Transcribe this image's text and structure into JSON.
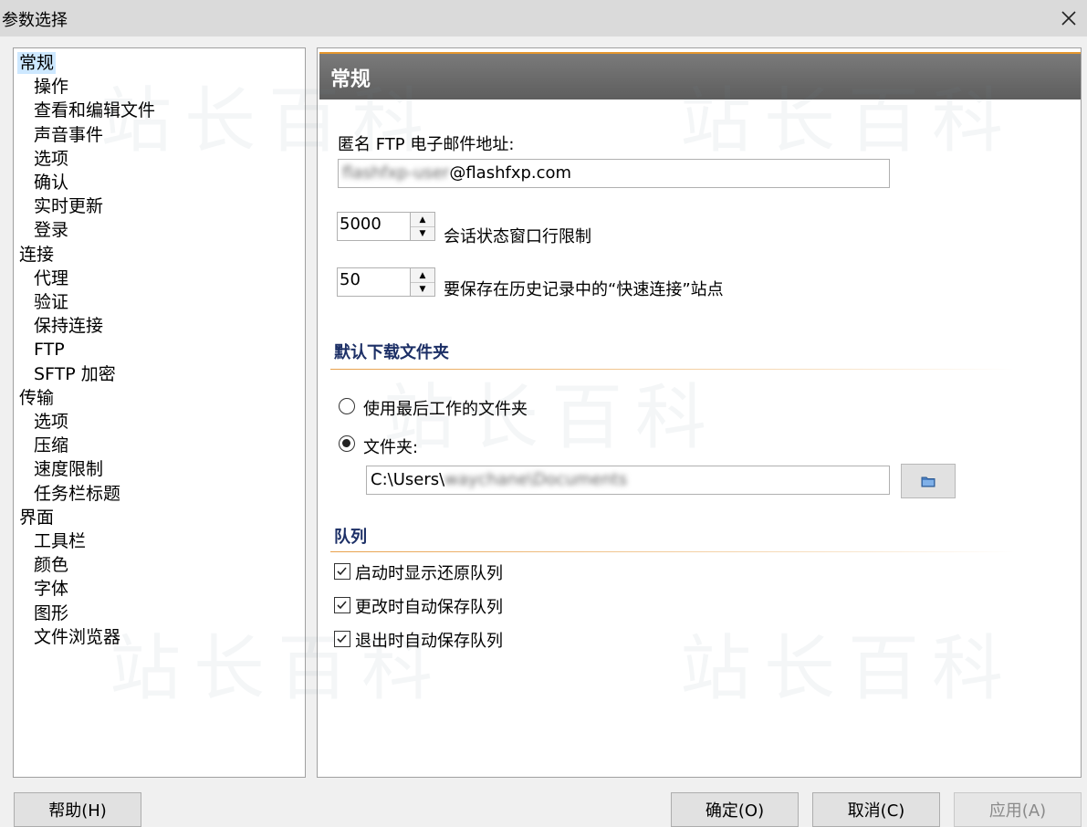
{
  "window": {
    "title": "参数选择"
  },
  "tree": [
    {
      "label": "常规",
      "level": 0,
      "selected": true
    },
    {
      "label": "操作",
      "level": 1
    },
    {
      "label": "查看和编辑文件",
      "level": 1
    },
    {
      "label": "声音事件",
      "level": 1
    },
    {
      "label": "选项",
      "level": 1
    },
    {
      "label": "确认",
      "level": 1
    },
    {
      "label": "实时更新",
      "level": 1
    },
    {
      "label": "登录",
      "level": 1
    },
    {
      "label": "连接",
      "level": 0
    },
    {
      "label": "代理",
      "level": 1
    },
    {
      "label": "验证",
      "level": 1
    },
    {
      "label": "保持连接",
      "level": 1
    },
    {
      "label": "FTP",
      "level": 1
    },
    {
      "label": "SFTP 加密",
      "level": 1
    },
    {
      "label": "传输",
      "level": 0
    },
    {
      "label": "选项",
      "level": 1
    },
    {
      "label": "压缩",
      "level": 1
    },
    {
      "label": "速度限制",
      "level": 1
    },
    {
      "label": "任务栏标题",
      "level": 1
    },
    {
      "label": "界面",
      "level": 0
    },
    {
      "label": "工具栏",
      "level": 1
    },
    {
      "label": "颜色",
      "level": 1
    },
    {
      "label": "字体",
      "level": 1
    },
    {
      "label": "图形",
      "level": 1
    },
    {
      "label": "文件浏览器",
      "level": 1
    }
  ],
  "panel": {
    "title": "常规",
    "anon_email_label": "匿名 FTP 电子邮件地址:",
    "anon_email_user": "flashfxp-user",
    "anon_email_domain": "@flashfxp.com",
    "session_limit_value": "5000",
    "session_limit_label": "会话状态窗口行限制",
    "history_value": "50",
    "history_label": "要保存在历史记录中的“快速连接”站点",
    "download_section": "默认下载文件夹",
    "radio_last_label": "使用最后工作的文件夹",
    "radio_folder_label": "文件夹:",
    "folder_prefix": "C:\\Users\\",
    "folder_rest": "waychane\\Documents",
    "queue_section": "队列",
    "queue_options": [
      {
        "label": "启动时显示还原队列",
        "checked": true
      },
      {
        "label": "更改时自动保存队列",
        "checked": true
      },
      {
        "label": "退出时自动保存队列",
        "checked": true
      }
    ]
  },
  "watermark": "站长百科",
  "buttons": {
    "help": "帮助(H)",
    "ok": "确定(O)",
    "cancel": "取消(C)",
    "apply": "应用(A)"
  },
  "icons": [
    "close-icon",
    "spin-up-icon",
    "spin-down-icon",
    "folder-icon",
    "check-icon"
  ]
}
